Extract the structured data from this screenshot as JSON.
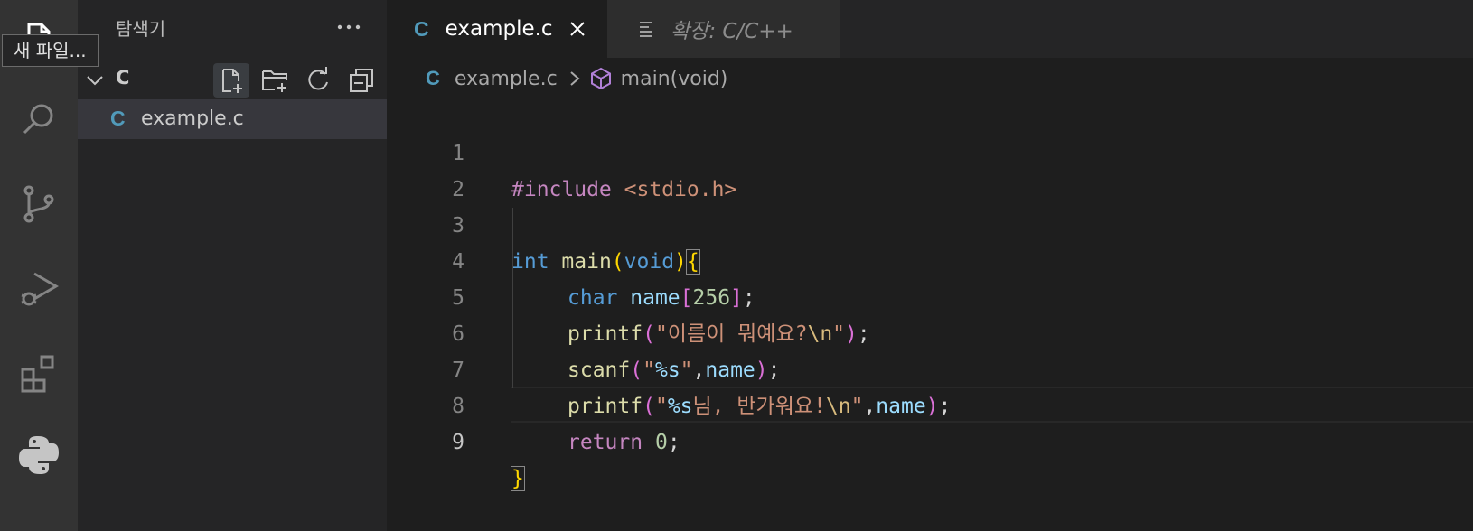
{
  "tooltip": "새 파일...",
  "sidebar": {
    "title": "탐색기",
    "folder": "C",
    "file": {
      "icon": "C",
      "name": "example.c"
    }
  },
  "tabs": [
    {
      "icon": "C",
      "label": "example.c",
      "active": true
    },
    {
      "icon": "preview-icon",
      "label": "확장: C/C++",
      "active": false
    }
  ],
  "breadcrumb": {
    "icon": "C",
    "file": "example.c",
    "symbol": "main(void)"
  },
  "editor": {
    "line_numbers": [
      "1",
      "2",
      "3",
      "4",
      "5",
      "6",
      "7",
      "8",
      "9"
    ],
    "current_line": 9,
    "lines": {
      "l1": {
        "directive": "#include",
        "header": "<stdio.h>"
      },
      "l3": {
        "type": "int",
        "name": "main",
        "open": "(",
        "param": "void",
        "close": ")",
        "brace": "{"
      },
      "l4": {
        "type": "char",
        "var": "name",
        "lb": "[",
        "size": "256",
        "rb": "]",
        "semi": ";"
      },
      "l5": {
        "fn": "printf",
        "lp": "(",
        "str": "\"이름이 뭐예요?",
        "esc": "\\n",
        "strend": "\"",
        "rp": ")",
        "semi": ";"
      },
      "l6": {
        "fn": "scanf",
        "lp": "(",
        "q1": "\"",
        "fmt": "%s",
        "q2": "\"",
        "comma": ",",
        "var": "name",
        "rp": ")",
        "semi": ";"
      },
      "l7": {
        "fn": "printf",
        "lp": "(",
        "q1": "\"",
        "fmt": "%s",
        "str": "님, 반가워요!",
        "esc": "\\n",
        "q2": "\"",
        "comma": ",",
        "var": "name",
        "rp": ")",
        "semi": ";"
      },
      "l8": {
        "kw": "return",
        "num": "0",
        "semi": ";"
      },
      "l9": {
        "brace": "}"
      }
    }
  },
  "colors": {
    "activity_bar": "#333333",
    "sidebar": "#252526",
    "editor": "#1e1e1e",
    "c_icon": "#519aba"
  }
}
